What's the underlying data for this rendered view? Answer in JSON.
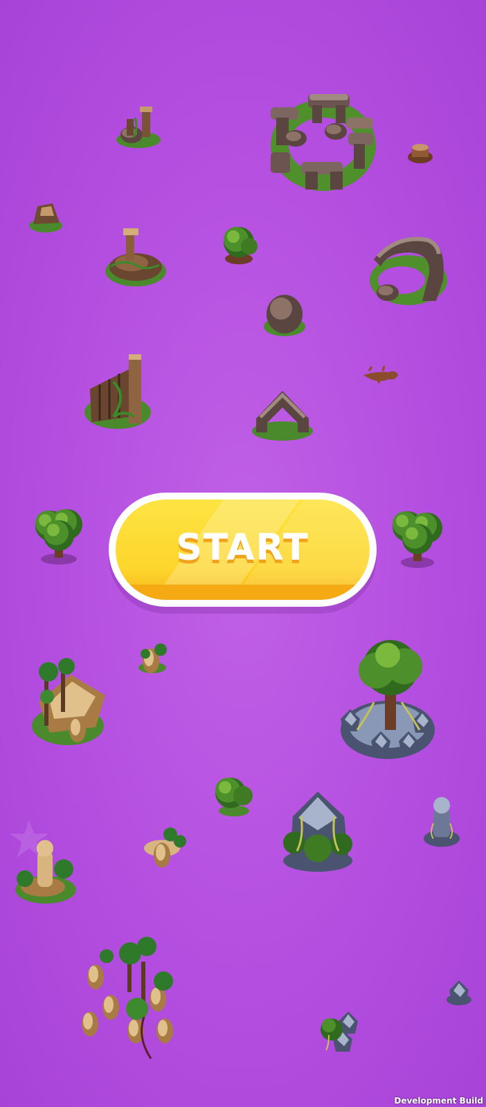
{
  "screen": {
    "background_color": "#b44ee0",
    "start_button": {
      "label": "START",
      "fill_color": "#fdd52c",
      "border_color": "#ffffff",
      "label_color": "#ffffff"
    },
    "build_label": "Development Build"
  },
  "map_objects": [
    "broken-pillar-ruin",
    "stonehenge-circle",
    "tree-stump",
    "small-rock-pile",
    "pillar-mound-ruin",
    "green-bush",
    "rock-arc-ruin",
    "boulder",
    "dead-lizard",
    "wooden-fence-ruin",
    "stone-arch",
    "bushy-tree-left",
    "bushy-tree-right",
    "small-sand-shrub",
    "sandstone-cliff-jungle",
    "giant-tree-on-ice-rocks",
    "round-bush",
    "crystal-rock-with-vines",
    "ice-statue",
    "sandstone-totem-ruin",
    "sandstone-pod-shrub",
    "sandstone-pillars-jungle",
    "ice-rock-small",
    "icy-bush-ruin"
  ]
}
